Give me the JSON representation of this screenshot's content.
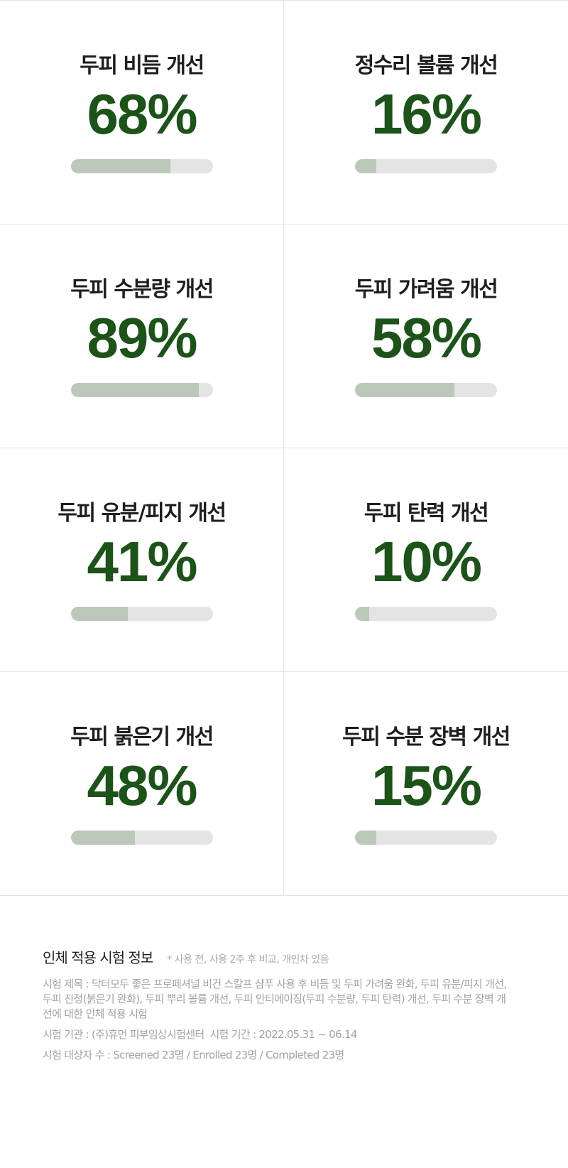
{
  "metrics": [
    {
      "title": "두피 비듬 개선",
      "value": "68%",
      "fraction": 0.7
    },
    {
      "title": "정수리 볼륨 개선",
      "value": "16%",
      "fraction": 0.15
    },
    {
      "title": "두피 수분량 개선",
      "value": "89%",
      "fraction": 0.9
    },
    {
      "title": "두피 가려움 개선",
      "value": "58%",
      "fraction": 0.7
    },
    {
      "title": "두피 유분/피지 개선",
      "value": "41%",
      "fraction": 0.4
    },
    {
      "title": "두피 탄력 개선",
      "value": "10%",
      "fraction": 0.1
    },
    {
      "title": "두피 붉은기 개선",
      "value": "48%",
      "fraction": 0.45
    },
    {
      "title": "두피 수분 장벽 개선",
      "value": "15%",
      "fraction": 0.15
    }
  ],
  "colors": {
    "value_text": "#1c5318",
    "bar_fill": "#bcc8ba",
    "bar_track": "#e4e4e4",
    "divider": "#e2e2e2"
  },
  "info": {
    "title": "인체 적용 시험 정보",
    "note": "* 사용 전, 사용 2주 후 비교, 개인차 있음",
    "test_title": "시험 제목 : 닥터모두 좋은 프로페셔널 비건 스칼프 샴푸 사용 후 비듬 및 두피 가려움 완화, 두피 유분/피지 개선, 두피 진정(붉은기 완화), 두피 뿌리 볼륨 개선, 두피 안티에이징(두피 수분량, 두피 탄력) 개선, 두피 수분 장벽 개선에 대한 인체 적용 시험",
    "institution": "시험 기관 : (주)휴먼 피부임상시험센터",
    "period": "시험 기간 : 2022.05.31 ~ 06.14",
    "subjects": "시험 대상자 수 : Screened 23명 / Enrolled 23명 / Completed 23명"
  }
}
